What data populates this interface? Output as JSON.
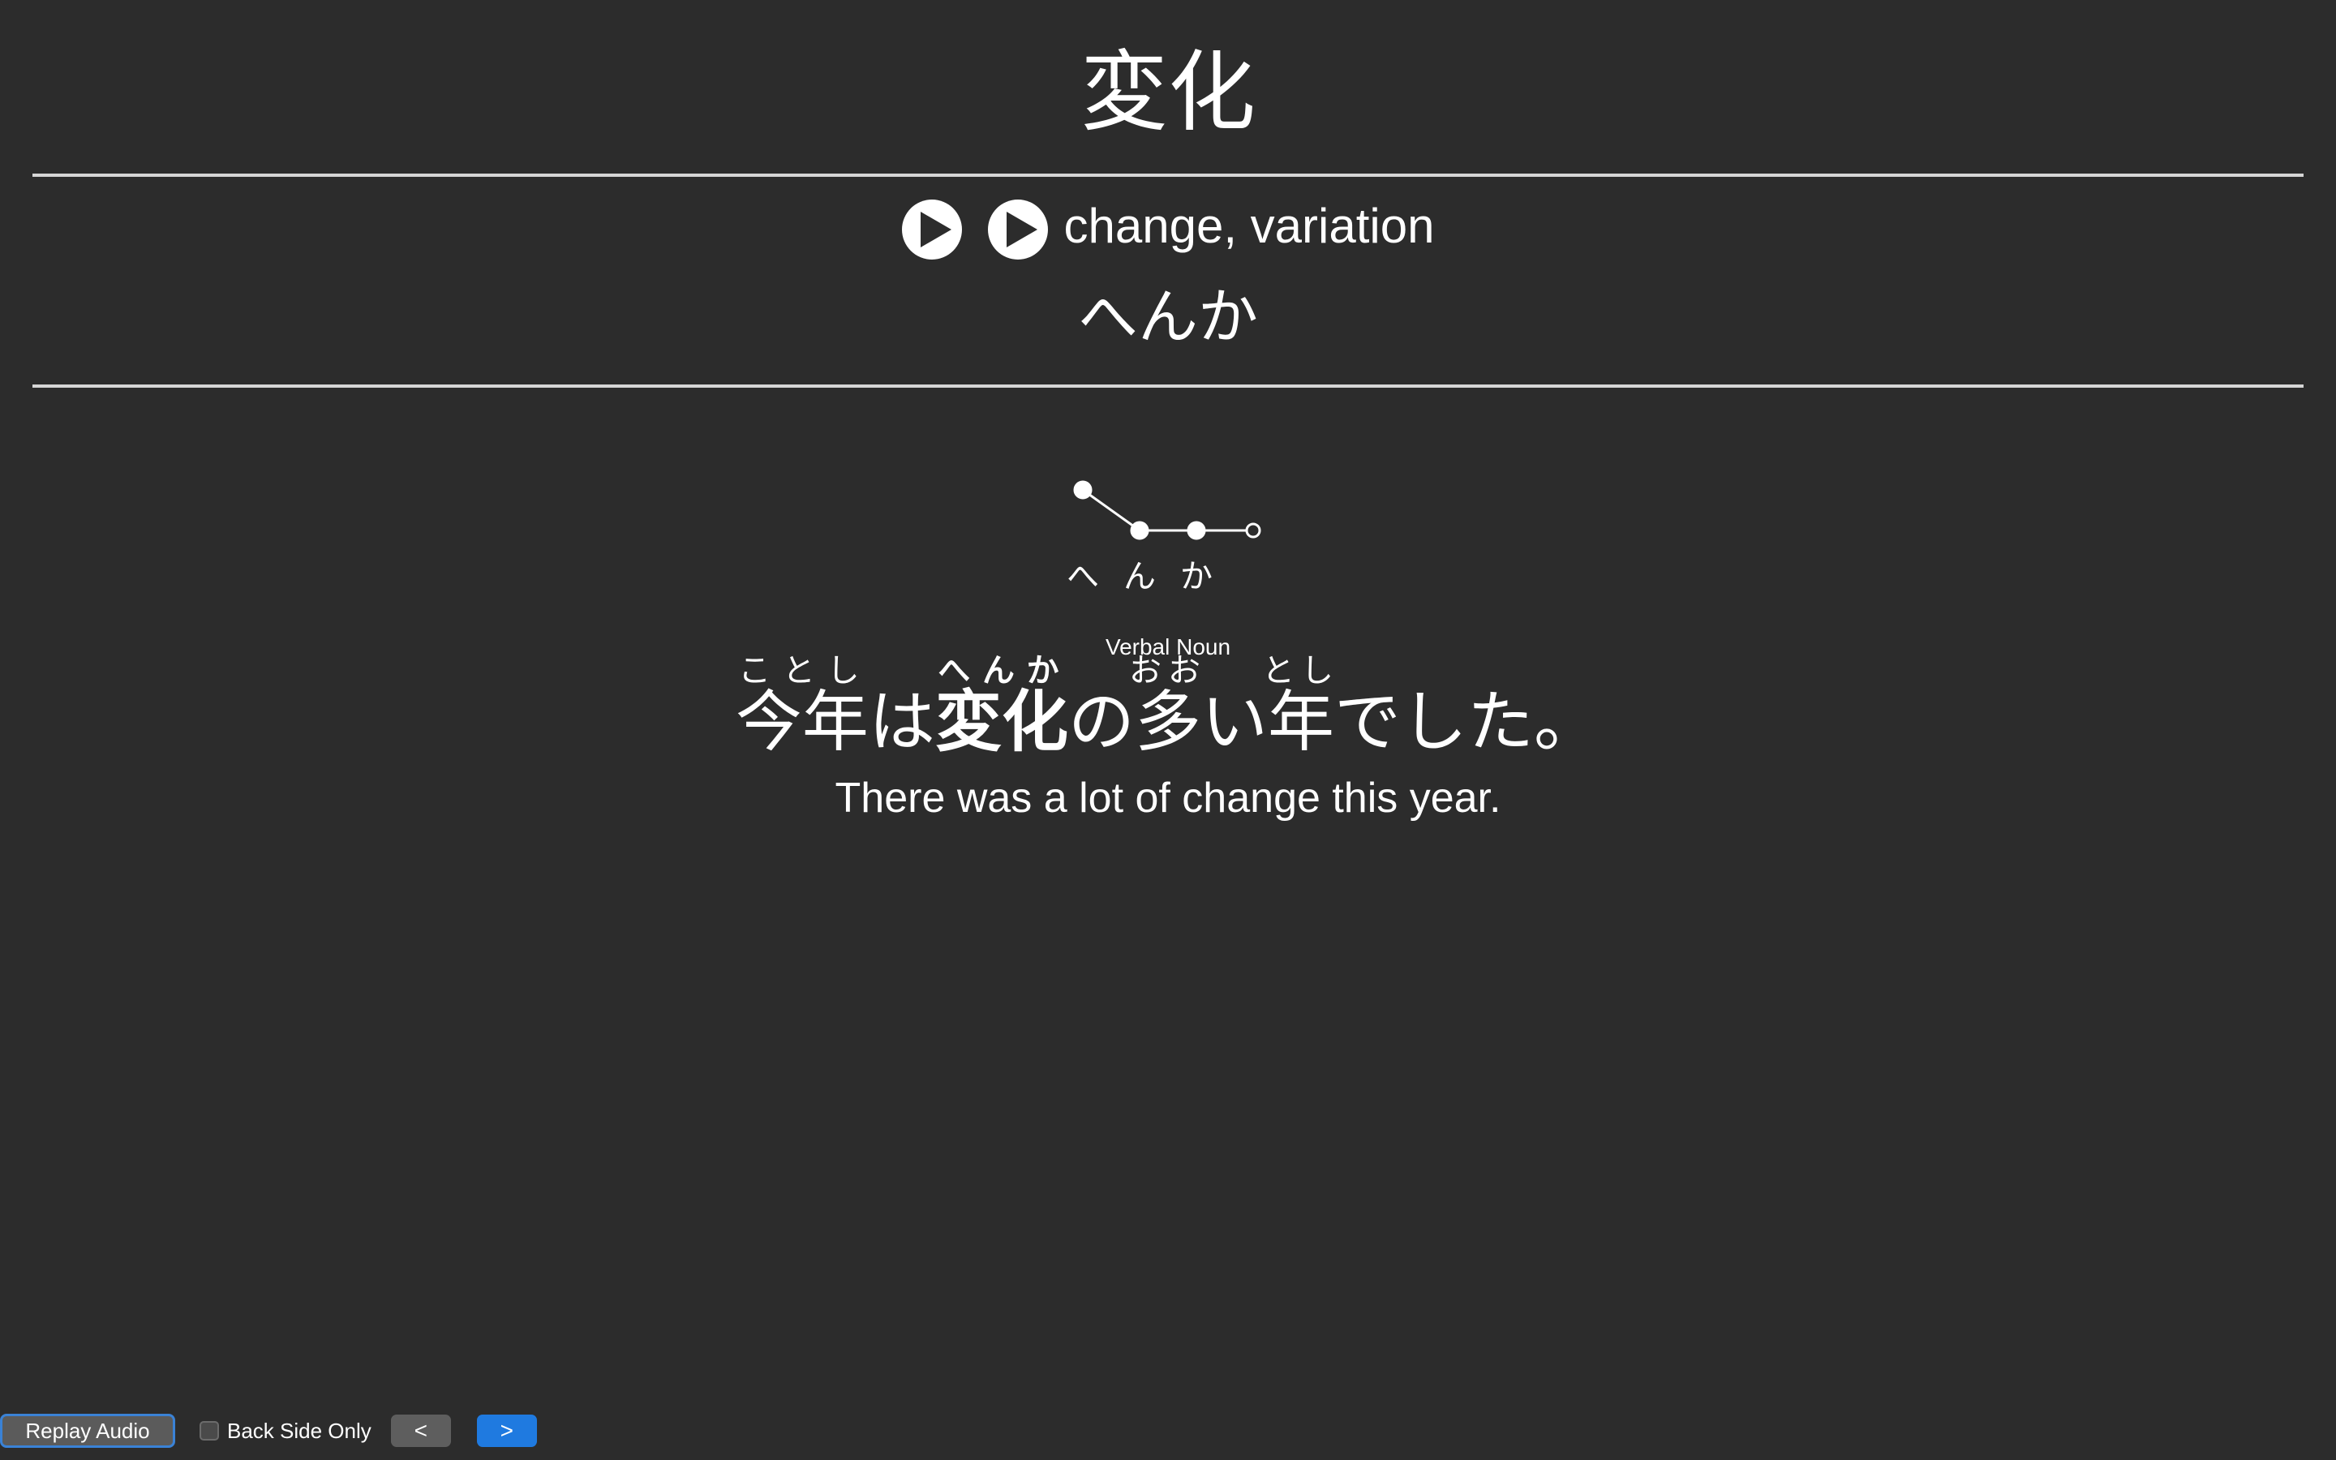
{
  "card": {
    "word": "変化",
    "meaning": "change, variation",
    "reading": "へんか",
    "pitch": {
      "morae": [
        "へ",
        "ん",
        "か"
      ],
      "levels": [
        "high",
        "low",
        "low",
        "low"
      ]
    },
    "part_of_speech": "Verbal Noun",
    "sentence": [
      {
        "text": "今年",
        "ruby": "ことし",
        "highlight": false
      },
      {
        "text": "は",
        "ruby": "",
        "highlight": false
      },
      {
        "text": "変化",
        "ruby": "へんか",
        "highlight": true
      },
      {
        "text": "の",
        "ruby": "",
        "highlight": false
      },
      {
        "text": "多",
        "ruby": "おお",
        "highlight": false
      },
      {
        "text": "い",
        "ruby": "",
        "highlight": false
      },
      {
        "text": "年",
        "ruby": "とし",
        "highlight": false
      },
      {
        "text": "でした。",
        "ruby": "",
        "highlight": false
      }
    ],
    "translation": "There was a lot of change this year."
  },
  "controls": {
    "replay_label": "Replay Audio",
    "back_side_only_label": "Back Side Only",
    "back_side_only_checked": false,
    "prev_label": "<",
    "next_label": ">"
  },
  "colors": {
    "background": "#2c2c2c",
    "text": "#ffffff",
    "divider": "#d6d6d6",
    "accent": "#1f7ae0",
    "replay_border": "#3a82d6"
  }
}
